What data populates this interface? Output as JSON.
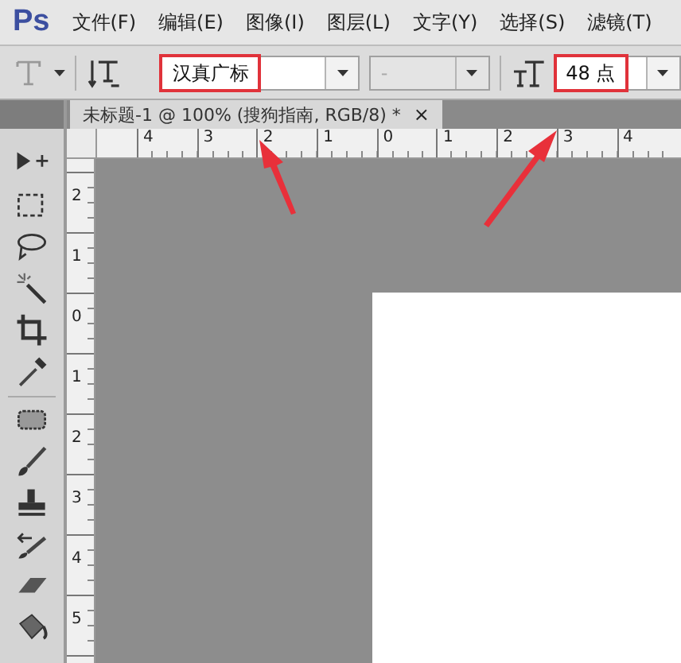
{
  "app": {
    "logo": "Ps"
  },
  "menu": [
    "文件(F)",
    "编辑(E)",
    "图像(I)",
    "图层(L)",
    "文字(Y)",
    "选择(S)",
    "滤镜(T)"
  ],
  "options_bar": {
    "font_family": {
      "value": "汉真广标",
      "highlighted": true
    },
    "font_style": {
      "value": "-",
      "disabled": true
    },
    "font_size": {
      "value": "48 点",
      "highlighted": true
    }
  },
  "document_tab": {
    "title": "未标题-1 @ 100% (搜狗指南, RGB/8) *",
    "close": "×"
  },
  "ruler_horizontal": [
    "4",
    "3",
    "2",
    "1",
    "0",
    "1",
    "2",
    "3",
    "4"
  ],
  "ruler_vertical": [
    "2",
    "1",
    "0",
    "1",
    "2",
    "3",
    "4",
    "5"
  ]
}
